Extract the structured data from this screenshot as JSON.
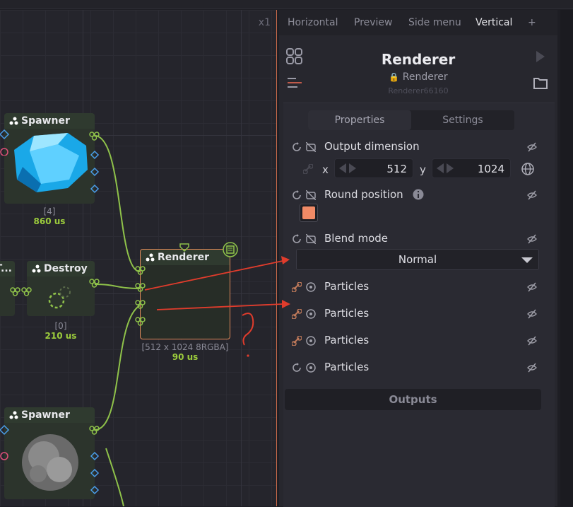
{
  "canvas": {
    "zoom_label": "x1"
  },
  "nodes": {
    "spawner1": {
      "title": "Spawner",
      "count": "[4]",
      "time": "860 us"
    },
    "destroy": {
      "title": "Destroy",
      "count": "[0]",
      "time": "210 us"
    },
    "cut_title": "T...",
    "renderer": {
      "title": "Renderer",
      "info": "[512 x 1024 8RGBA]",
      "time": "90 us"
    },
    "spawner2": {
      "title": "Spawner"
    }
  },
  "panel_tabs": [
    "Horizontal",
    "Preview",
    "Side menu",
    "Vertical",
    "+"
  ],
  "inspector": {
    "title": "Renderer",
    "subtitle": "Renderer",
    "id": "Renderer66160",
    "prop_tabs": [
      "Properties",
      "Settings"
    ],
    "output_dimension": {
      "label": "Output dimension",
      "x_label": "x",
      "x": "512",
      "y_label": "y",
      "y": "1024"
    },
    "round_position": {
      "label": "Round position",
      "color": "#f08a66"
    },
    "blend_mode": {
      "label": "Blend mode",
      "value": "Normal"
    },
    "particles": [
      "Particles",
      "Particles",
      "Particles",
      "Particles"
    ],
    "outputs_label": "Outputs"
  },
  "colors": {
    "accent": "#9ccc3c",
    "selection": "#e08a5a",
    "annotation": "#e03c2c"
  }
}
